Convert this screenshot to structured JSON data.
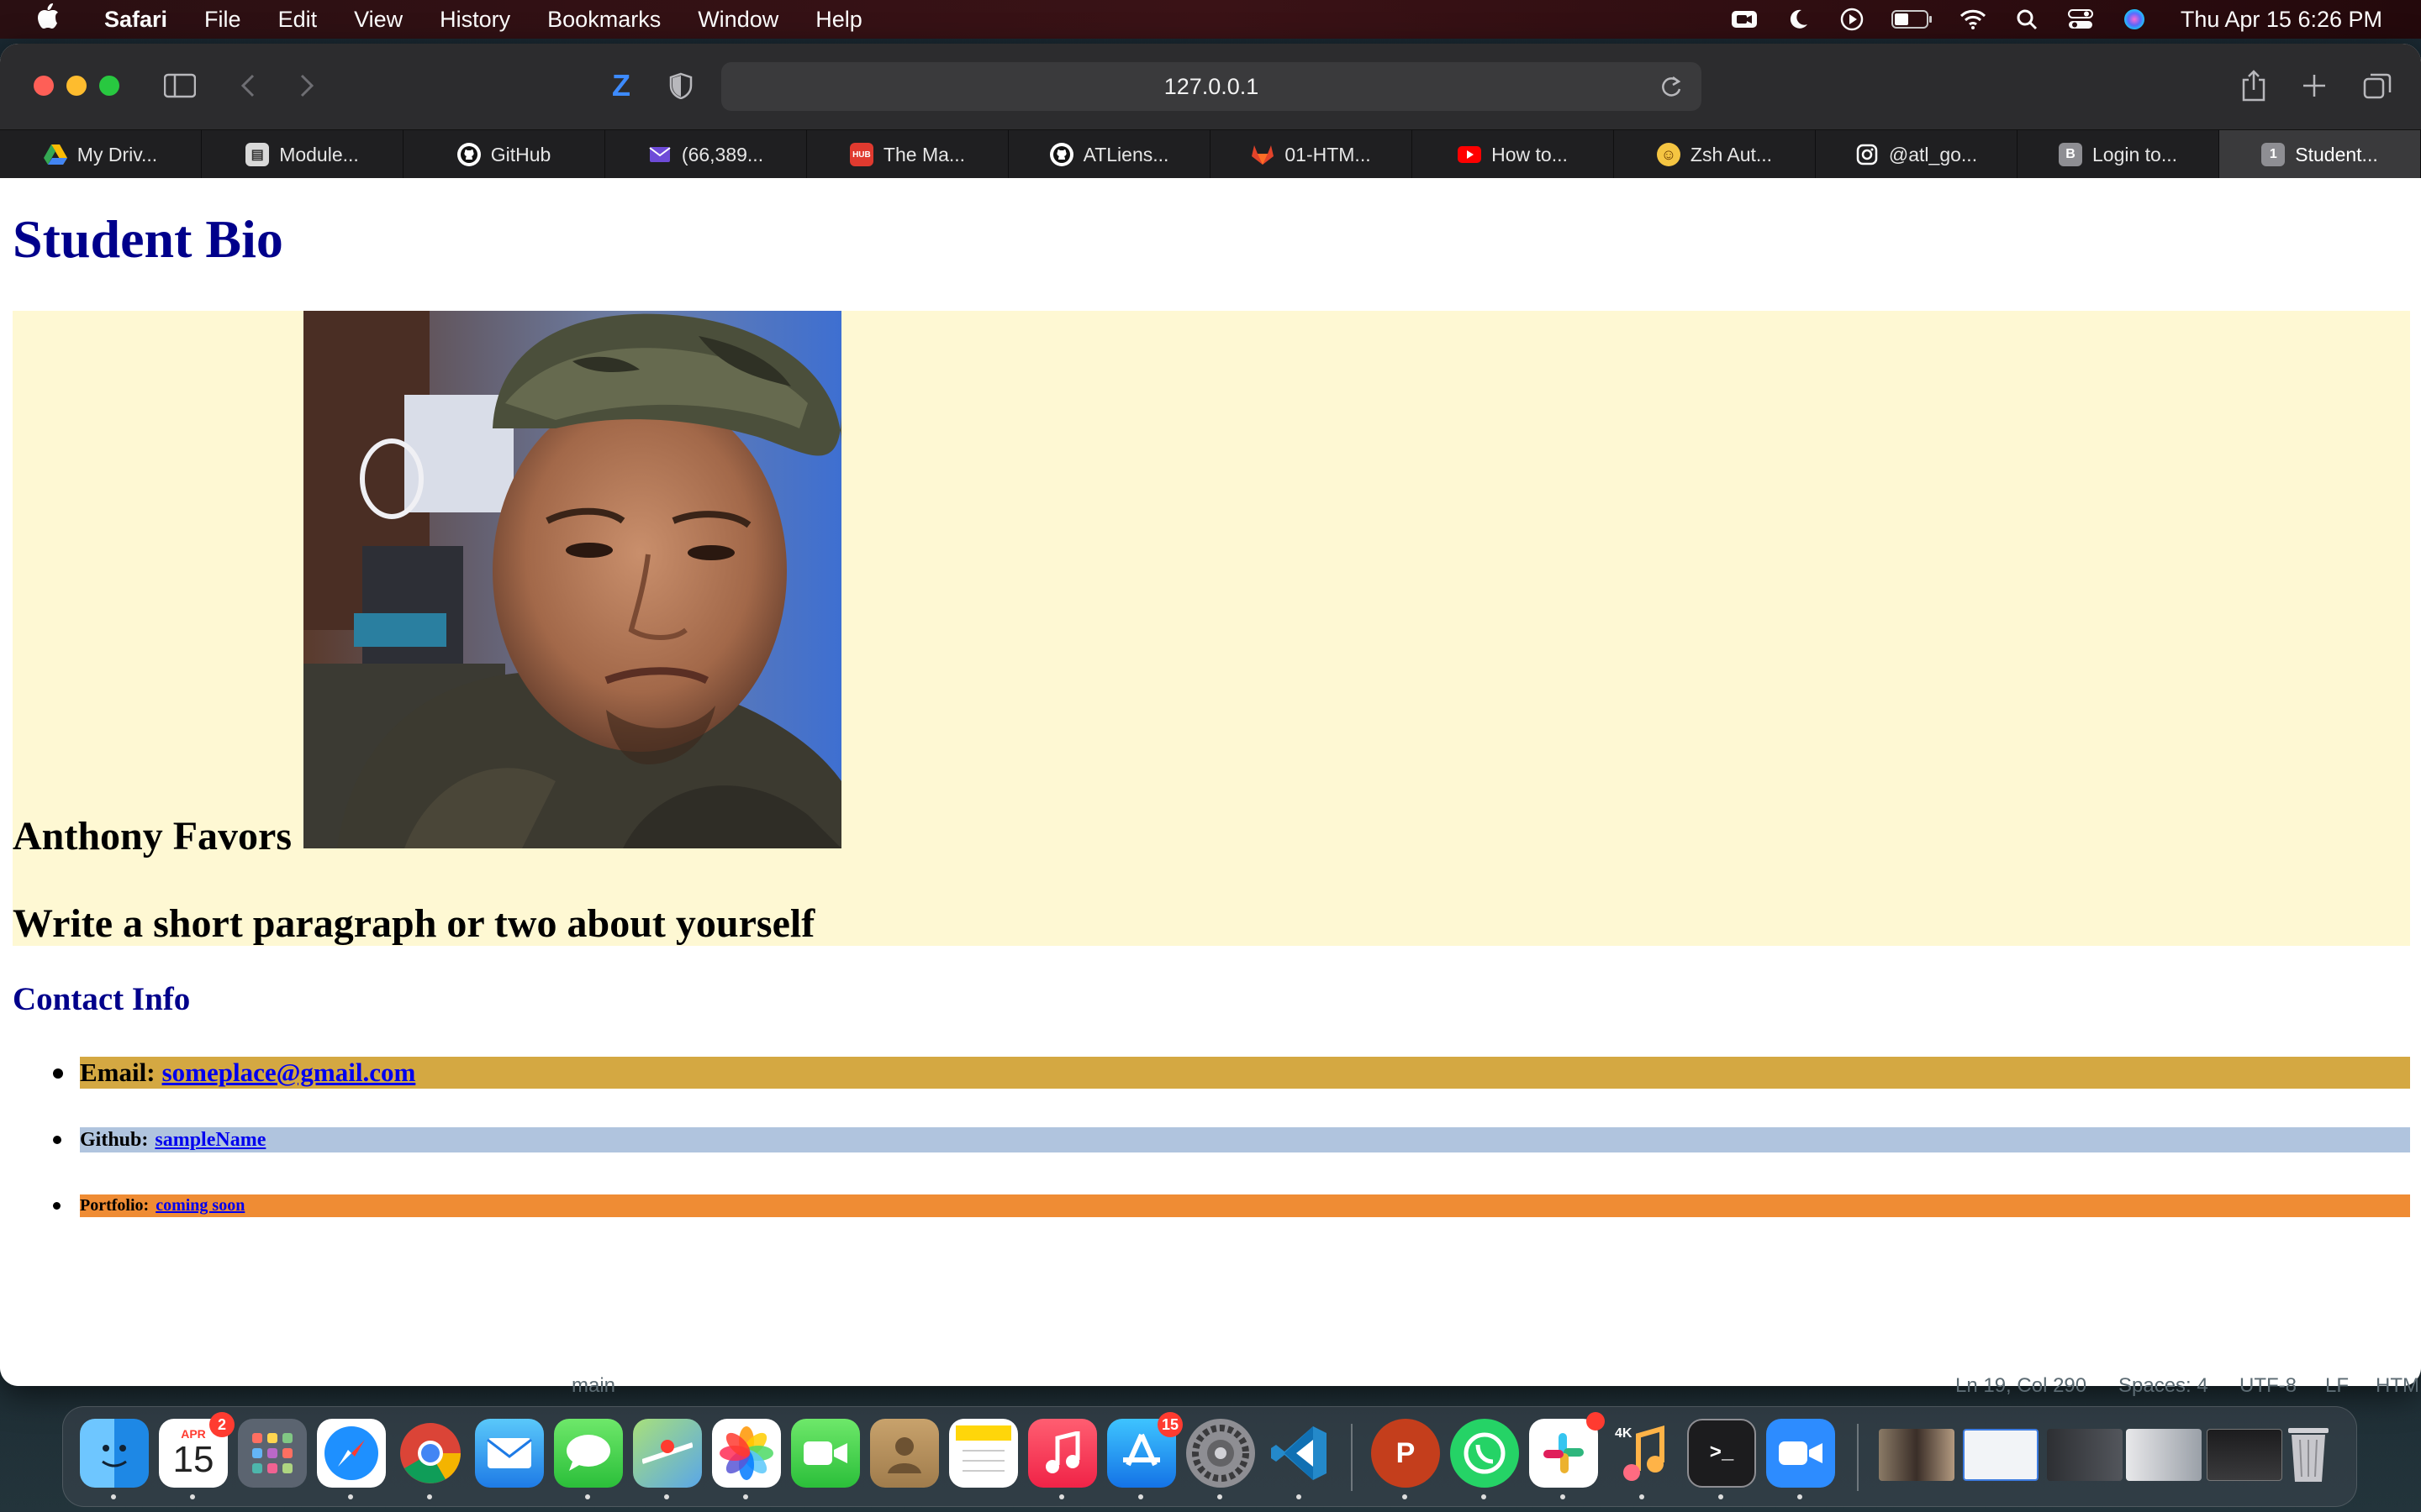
{
  "menubar": {
    "app_name": "Safari",
    "items": [
      "File",
      "Edit",
      "View",
      "History",
      "Bookmarks",
      "Window",
      "Help"
    ],
    "clock": "Thu Apr 15  6:26 PM",
    "status_icons": [
      "facetime-icon",
      "moon-icon",
      "play-icon",
      "battery-icon",
      "wifi-icon",
      "search-icon",
      "control-center-icon",
      "siri-icon"
    ]
  },
  "browser": {
    "url": "127.0.0.1",
    "tabs": [
      {
        "label": "My Driv...",
        "icon": "google-drive-icon",
        "color": "#34a853"
      },
      {
        "label": "Module...",
        "icon": "module-icon",
        "color": "#cfcfcf"
      },
      {
        "label": "GitHub",
        "icon": "github-icon",
        "color": "#ffffff"
      },
      {
        "label": "(66,389...",
        "icon": "mail-icon",
        "color": "#6e4bd8"
      },
      {
        "label": "The Ma...",
        "icon": "hub-icon",
        "color": "#e03a2f"
      },
      {
        "label": "ATLiens...",
        "icon": "github-icon",
        "color": "#ffffff"
      },
      {
        "label": "01-HTM...",
        "icon": "gitlab-icon",
        "color": "#e2432a"
      },
      {
        "label": "How to...",
        "icon": "youtube-icon",
        "color": "#ff0000"
      },
      {
        "label": "Zsh Aut...",
        "icon": "emoji-icon",
        "color": "#f5c542"
      },
      {
        "label": "@atl_go...",
        "icon": "instagram-icon",
        "color": "#ffffff"
      },
      {
        "label": "Login to...",
        "icon": "b-icon",
        "color": "#8e8e93"
      },
      {
        "label": "Student...",
        "icon": "number-1-icon",
        "color": "#8e8e93"
      }
    ],
    "active_tab_index": 11
  },
  "page": {
    "title": "Student Bio",
    "name": "Anthony Favors",
    "about": "Write a short paragraph or two about yourself",
    "contact_title": "Contact Info",
    "contacts": [
      {
        "label": "Email:",
        "link": "someplace@gmail.com",
        "color": "#d4a842"
      },
      {
        "label": "Github:",
        "link": "sampleName",
        "color": "#b0c4de"
      },
      {
        "label": "Portfolio:",
        "link": "coming soon",
        "color": "#ef8c34"
      }
    ]
  },
  "editor_status": {
    "branch": "main",
    "position": "Ln 19, Col 290",
    "spaces": "Spaces: 4",
    "encoding": "UTF-8",
    "eol": "LF",
    "lang": "HTML"
  },
  "dock": {
    "calendar_month": "APR",
    "calendar_day": "15",
    "calendar_badge": "2",
    "appstore_badge": "15",
    "apps": [
      "finder",
      "calendar",
      "launchpad",
      "safari",
      "chrome",
      "mail",
      "messages",
      "maps",
      "photos",
      "facetime",
      "contacts",
      "notes",
      "music",
      "app-store",
      "system-preferences",
      "vscode",
      "powerpoint",
      "whatsapp",
      "slack",
      "music-4k",
      "terminal",
      "zoom"
    ]
  }
}
